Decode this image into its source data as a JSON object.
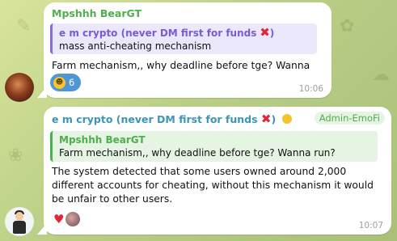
{
  "messages": [
    {
      "sender": "Mpshhh BearGT",
      "reply_to": {
        "author": "e m crypto (never DM first for funds",
        "author_suffix": ")",
        "text": "mass anti-cheating mechanism"
      },
      "text": "Farm mechanism,, why deadline before tge? Wanna run?",
      "reaction_count": "6",
      "time": "10:06"
    },
    {
      "sender": "e m crypto (never DM first for funds",
      "sender_suffix": ")",
      "role": "Admin-EmoFi",
      "reply_to": {
        "author": "Mpshhh BearGT",
        "text": "Farm mechanism,, why deadline before tge? Wanna run?"
      },
      "text": "The system detected that some users owned around 2,000 different accounts for cheating, without this mechanism it would be unfair to other users.",
      "time": "10:07"
    }
  ],
  "colors": {
    "sender_green": "#4fae4e",
    "sender_blue": "#3a96b8",
    "quote_purple": "#8c6ad9",
    "reaction_blue": "#4d97d6",
    "x_red": "#e0263a"
  }
}
